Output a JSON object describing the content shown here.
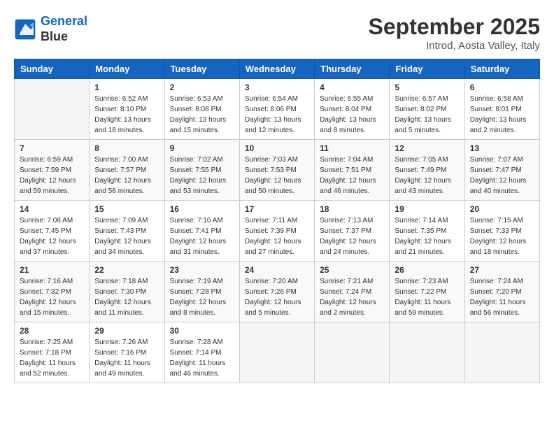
{
  "header": {
    "logo_line1": "General",
    "logo_line2": "Blue",
    "month_title": "September 2025",
    "subtitle": "Introd, Aosta Valley, Italy"
  },
  "weekdays": [
    "Sunday",
    "Monday",
    "Tuesday",
    "Wednesday",
    "Thursday",
    "Friday",
    "Saturday"
  ],
  "weeks": [
    [
      {
        "day": "",
        "info": ""
      },
      {
        "day": "1",
        "info": "Sunrise: 6:52 AM\nSunset: 8:10 PM\nDaylight: 13 hours\nand 18 minutes."
      },
      {
        "day": "2",
        "info": "Sunrise: 6:53 AM\nSunset: 8:08 PM\nDaylight: 13 hours\nand 15 minutes."
      },
      {
        "day": "3",
        "info": "Sunrise: 6:54 AM\nSunset: 8:06 PM\nDaylight: 13 hours\nand 12 minutes."
      },
      {
        "day": "4",
        "info": "Sunrise: 6:55 AM\nSunset: 8:04 PM\nDaylight: 13 hours\nand 8 minutes."
      },
      {
        "day": "5",
        "info": "Sunrise: 6:57 AM\nSunset: 8:02 PM\nDaylight: 13 hours\nand 5 minutes."
      },
      {
        "day": "6",
        "info": "Sunrise: 6:58 AM\nSunset: 8:01 PM\nDaylight: 13 hours\nand 2 minutes."
      }
    ],
    [
      {
        "day": "7",
        "info": "Sunrise: 6:59 AM\nSunset: 7:59 PM\nDaylight: 12 hours\nand 59 minutes."
      },
      {
        "day": "8",
        "info": "Sunrise: 7:00 AM\nSunset: 7:57 PM\nDaylight: 12 hours\nand 56 minutes."
      },
      {
        "day": "9",
        "info": "Sunrise: 7:02 AM\nSunset: 7:55 PM\nDaylight: 12 hours\nand 53 minutes."
      },
      {
        "day": "10",
        "info": "Sunrise: 7:03 AM\nSunset: 7:53 PM\nDaylight: 12 hours\nand 50 minutes."
      },
      {
        "day": "11",
        "info": "Sunrise: 7:04 AM\nSunset: 7:51 PM\nDaylight: 12 hours\nand 46 minutes."
      },
      {
        "day": "12",
        "info": "Sunrise: 7:05 AM\nSunset: 7:49 PM\nDaylight: 12 hours\nand 43 minutes."
      },
      {
        "day": "13",
        "info": "Sunrise: 7:07 AM\nSunset: 7:47 PM\nDaylight: 12 hours\nand 40 minutes."
      }
    ],
    [
      {
        "day": "14",
        "info": "Sunrise: 7:08 AM\nSunset: 7:45 PM\nDaylight: 12 hours\nand 37 minutes."
      },
      {
        "day": "15",
        "info": "Sunrise: 7:09 AM\nSunset: 7:43 PM\nDaylight: 12 hours\nand 34 minutes."
      },
      {
        "day": "16",
        "info": "Sunrise: 7:10 AM\nSunset: 7:41 PM\nDaylight: 12 hours\nand 31 minutes."
      },
      {
        "day": "17",
        "info": "Sunrise: 7:11 AM\nSunset: 7:39 PM\nDaylight: 12 hours\nand 27 minutes."
      },
      {
        "day": "18",
        "info": "Sunrise: 7:13 AM\nSunset: 7:37 PM\nDaylight: 12 hours\nand 24 minutes."
      },
      {
        "day": "19",
        "info": "Sunrise: 7:14 AM\nSunset: 7:35 PM\nDaylight: 12 hours\nand 21 minutes."
      },
      {
        "day": "20",
        "info": "Sunrise: 7:15 AM\nSunset: 7:33 PM\nDaylight: 12 hours\nand 18 minutes."
      }
    ],
    [
      {
        "day": "21",
        "info": "Sunrise: 7:16 AM\nSunset: 7:32 PM\nDaylight: 12 hours\nand 15 minutes."
      },
      {
        "day": "22",
        "info": "Sunrise: 7:18 AM\nSunset: 7:30 PM\nDaylight: 12 hours\nand 11 minutes."
      },
      {
        "day": "23",
        "info": "Sunrise: 7:19 AM\nSunset: 7:28 PM\nDaylight: 12 hours\nand 8 minutes."
      },
      {
        "day": "24",
        "info": "Sunrise: 7:20 AM\nSunset: 7:26 PM\nDaylight: 12 hours\nand 5 minutes."
      },
      {
        "day": "25",
        "info": "Sunrise: 7:21 AM\nSunset: 7:24 PM\nDaylight: 12 hours\nand 2 minutes."
      },
      {
        "day": "26",
        "info": "Sunrise: 7:23 AM\nSunset: 7:22 PM\nDaylight: 11 hours\nand 59 minutes."
      },
      {
        "day": "27",
        "info": "Sunrise: 7:24 AM\nSunset: 7:20 PM\nDaylight: 11 hours\nand 56 minutes."
      }
    ],
    [
      {
        "day": "28",
        "info": "Sunrise: 7:25 AM\nSunset: 7:18 PM\nDaylight: 11 hours\nand 52 minutes."
      },
      {
        "day": "29",
        "info": "Sunrise: 7:26 AM\nSunset: 7:16 PM\nDaylight: 11 hours\nand 49 minutes."
      },
      {
        "day": "30",
        "info": "Sunrise: 7:28 AM\nSunset: 7:14 PM\nDaylight: 11 hours\nand 46 minutes."
      },
      {
        "day": "",
        "info": ""
      },
      {
        "day": "",
        "info": ""
      },
      {
        "day": "",
        "info": ""
      },
      {
        "day": "",
        "info": ""
      }
    ]
  ]
}
